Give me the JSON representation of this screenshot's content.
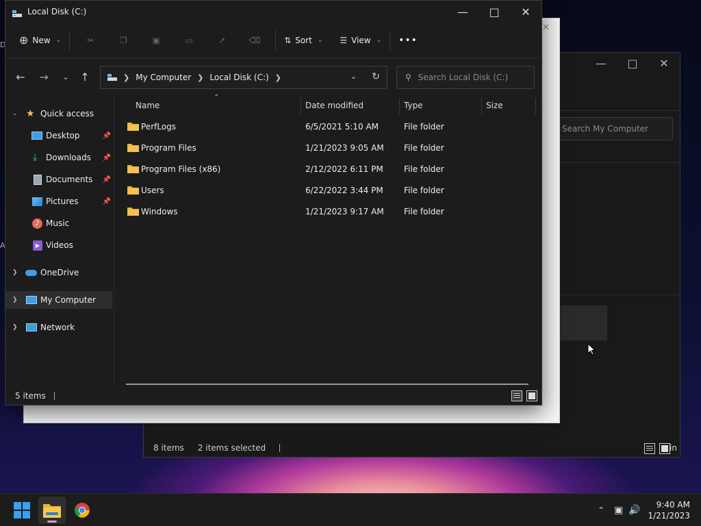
{
  "desktop": {
    "fragment_top": "D",
    "fragment_mid": "A"
  },
  "back_window_c": {
    "search_placeholder": "Search My Computer",
    "status": {
      "items": "8 items",
      "selected": "2 items selected"
    },
    "edge_text": "in"
  },
  "window": {
    "title": "Local Disk (C:)",
    "toolbar": {
      "new_label": "New",
      "sort_label": "Sort",
      "view_label": "View"
    },
    "address": {
      "crumbs": [
        "My Computer",
        "Local Disk (C:)"
      ]
    },
    "search_placeholder": "Search Local Disk (C:)",
    "sidebar": {
      "quick_access": "Quick access",
      "items": [
        "Desktop",
        "Downloads",
        "Documents",
        "Pictures",
        "Music",
        "Videos"
      ],
      "onedrive": "OneDrive",
      "my_computer": "My Computer",
      "network": "Network"
    },
    "columns": {
      "name": "Name",
      "date": "Date modified",
      "type": "Type",
      "size": "Size"
    },
    "files": [
      {
        "name": "PerfLogs",
        "date": "6/5/2021 5:10 AM",
        "type": "File folder",
        "size": ""
      },
      {
        "name": "Program Files",
        "date": "1/21/2023 9:05 AM",
        "type": "File folder",
        "size": ""
      },
      {
        "name": "Program Files (x86)",
        "date": "2/12/2022 6:11 PM",
        "type": "File folder",
        "size": ""
      },
      {
        "name": "Users",
        "date": "6/22/2022 3:44 PM",
        "type": "File folder",
        "size": ""
      },
      {
        "name": "Windows",
        "date": "1/21/2023 9:17 AM",
        "type": "File folder",
        "size": ""
      }
    ],
    "status_count": "5 items"
  },
  "taskbar": {
    "time": "9:40 AM",
    "date": "1/21/2023"
  },
  "colors": {
    "accent_folder": "#f2c14e",
    "selection": "#2d2d2d",
    "taskbar_indicator": "#d59ad0"
  }
}
